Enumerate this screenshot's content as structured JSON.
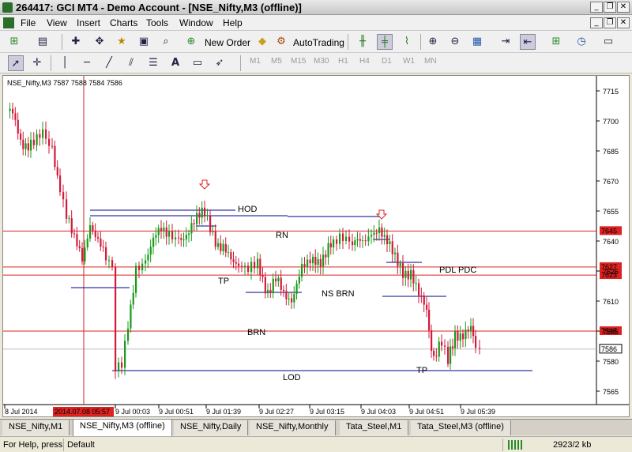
{
  "window": {
    "title": "264417: GCI MT4 - Demo Account - [NSE_Nifty,M3 (offline)]"
  },
  "menu": [
    "File",
    "View",
    "Insert",
    "Charts",
    "Tools",
    "Window",
    "Help"
  ],
  "toolbar": {
    "new_order": "New Order",
    "autotrading": "AutoTrading",
    "timeframes": [
      "M1",
      "M5",
      "M15",
      "M30",
      "H1",
      "H4",
      "D1",
      "W1",
      "MN"
    ]
  },
  "chart": {
    "header": "NSE_Nifty,M3  7587 7588 7584 7586",
    "y_ticks": [
      "7715",
      "7700",
      "7685",
      "7670",
      "7655",
      "7640",
      "7625",
      "7610",
      "7595",
      "7580",
      "7565"
    ],
    "x_ticks": [
      "8 Jul 2014",
      "9 Jul 00:03",
      "9 Jul 00:51",
      "9 Jul 01:39",
      "9 Jul 02:27",
      "9 Jul 03:15",
      "9 Jul 04:03",
      "9 Jul 04:51",
      "9 Jul 05:39"
    ],
    "crosshair_time": "2014.07.08 05:57",
    "price_labels": [
      "7645",
      "7627",
      "7623",
      "7595",
      "7586"
    ],
    "annotations": [
      "HOD",
      "RN",
      "TP",
      "NS BRN",
      "PDL PDC",
      "BRN",
      "LOD",
      "TP"
    ]
  },
  "chart_data": {
    "type": "candlestick",
    "ylim": [
      7560,
      7720
    ],
    "levels": [
      7645,
      7627,
      7623,
      7595,
      7586
    ],
    "last_price": 7586
  },
  "tabs": [
    {
      "label": "NSE_Nifty,M1",
      "active": false
    },
    {
      "label": "NSE_Nifty,M3 (offline)",
      "active": true
    },
    {
      "label": "NSE_Nifty,Daily",
      "active": false
    },
    {
      "label": "NSE_Nifty,Monthly",
      "active": false
    },
    {
      "label": "Tata_Steel,M1",
      "active": false
    },
    {
      "label": "Tata_Steel,M3 (offline)",
      "active": false
    }
  ],
  "status": {
    "help": "For Help, press",
    "profile": "Default",
    "traffic": "2923/2 kb"
  }
}
